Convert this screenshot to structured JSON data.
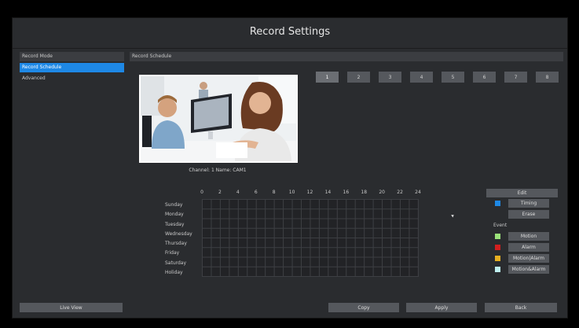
{
  "window": {
    "title": "Record Settings"
  },
  "sidebar": {
    "items": [
      {
        "label": "Record Mode",
        "state": "head"
      },
      {
        "label": "Record Schedule",
        "state": "active"
      },
      {
        "label": "Advanced",
        "state": "plain"
      }
    ]
  },
  "panel": {
    "header": "Record Schedule"
  },
  "preview": {
    "channel_label": "Channel: 1  Name: CAM1"
  },
  "channels": [
    "1",
    "2",
    "3",
    "4",
    "5",
    "6",
    "7",
    "8"
  ],
  "schedule": {
    "hours": [
      "0",
      "2",
      "4",
      "6",
      "8",
      "10",
      "12",
      "14",
      "16",
      "18",
      "20",
      "22",
      "24"
    ],
    "days": [
      "Sunday",
      "Monday",
      "Tuesday",
      "Wednesday",
      "Thursday",
      "Friday",
      "Saturday",
      "Holiday"
    ]
  },
  "right_controls": {
    "edit": "Edit",
    "timing": "Timing",
    "erase": "Erase",
    "event_title": "Event",
    "events": [
      {
        "label": "Motion",
        "color": "#9be37a"
      },
      {
        "label": "Alarm",
        "color": "#d21f1f"
      },
      {
        "label": "Motion|Alarm",
        "color": "#e8b021"
      },
      {
        "label": "Motion&Alarm",
        "color": "#bff0f0"
      }
    ],
    "timing_color": "#1e88e5"
  },
  "bottom": {
    "live_view": "Live View",
    "copy": "Copy",
    "apply": "Apply",
    "back": "Back"
  }
}
